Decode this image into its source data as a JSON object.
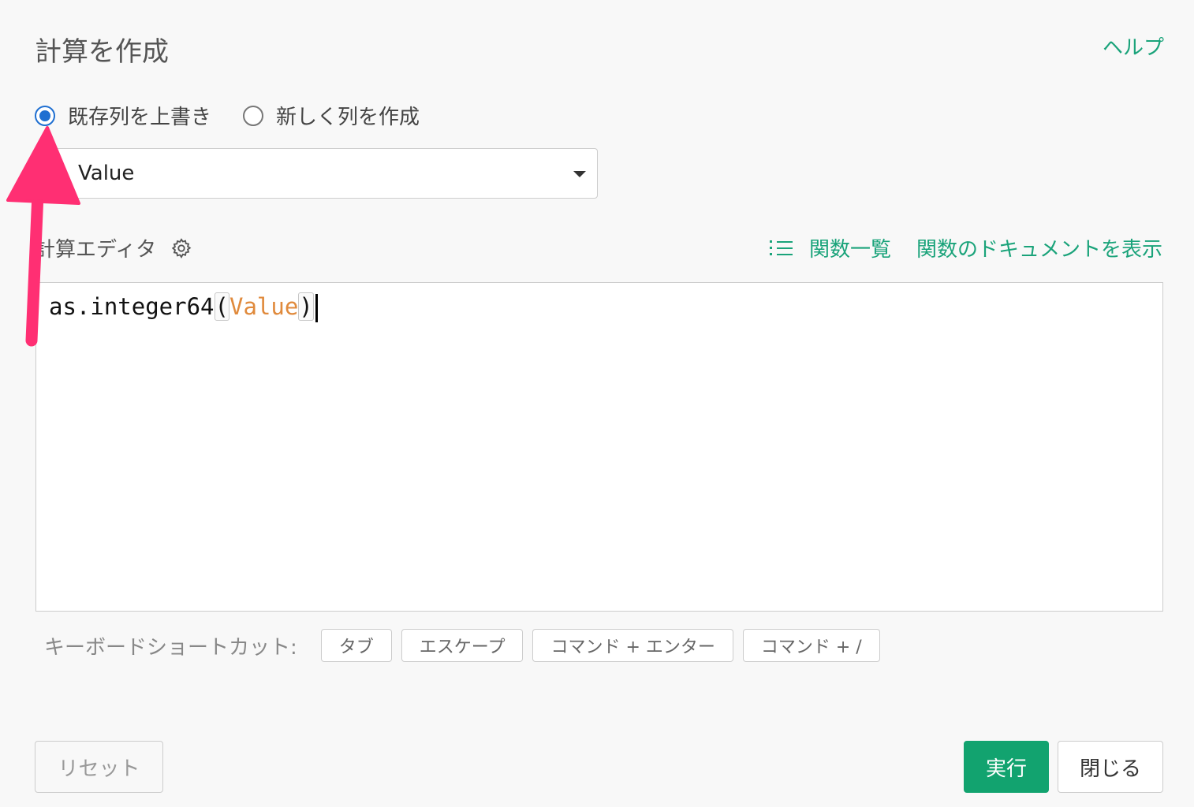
{
  "dialog": {
    "title": "計算を作成",
    "help_label": "ヘルプ"
  },
  "mode": {
    "options": [
      {
        "label": "既存列を上書き",
        "checked": true
      },
      {
        "label": "新しく列を作成",
        "checked": false
      }
    ]
  },
  "column_select": {
    "selected": "Value"
  },
  "editor": {
    "label": "計算エディタ",
    "function_list_label": "関数一覧",
    "docs_label": "関数のドキュメントを表示",
    "code": {
      "prefix": "as.integer64",
      "open_paren": "(",
      "argument": "Value",
      "close_paren": ")"
    }
  },
  "shortcuts": {
    "label": "キーボードショートカット:",
    "keys": [
      "タブ",
      "エスケープ",
      "コマンド + エンター",
      "コマンド + /"
    ]
  },
  "footer": {
    "reset_label": "リセット",
    "run_label": "実行",
    "close_label": "閉じる"
  },
  "colors": {
    "accent_green": "#1aa37a",
    "run_button": "#12a36f",
    "radio_blue": "#1f6fd1",
    "argument_orange": "#e08a3c",
    "annotation_arrow": "#ff2f73"
  }
}
